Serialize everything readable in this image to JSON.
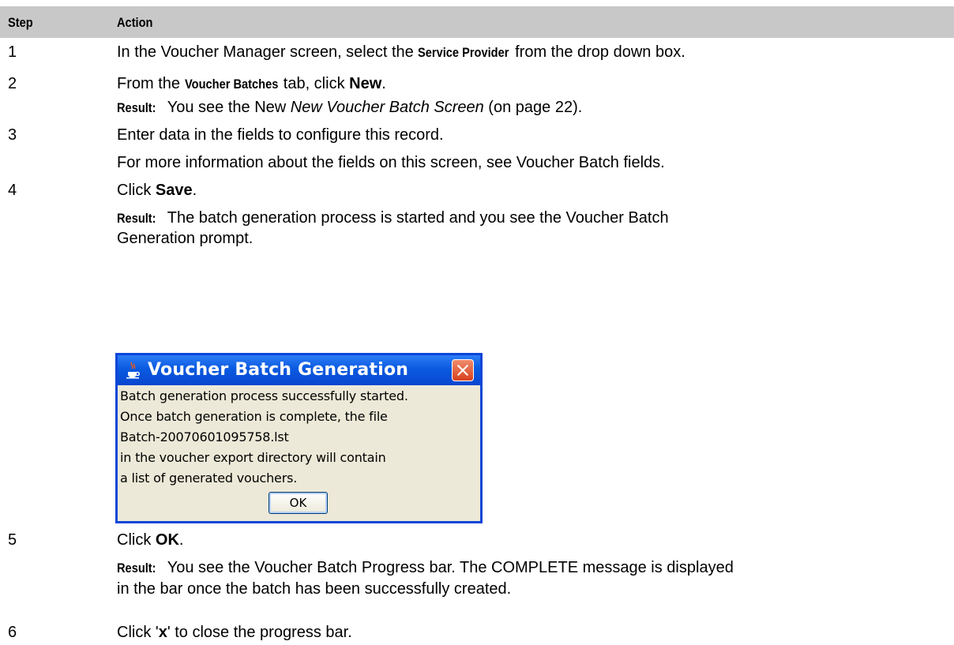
{
  "table": {
    "header_step": "Step",
    "header_action": "Action"
  },
  "steps": [
    {
      "num": "1",
      "pre": "In the Voucher Manager screen, select the ",
      "bold": "Service Provider",
      "post": " from the drop down box."
    },
    {
      "num": "2",
      "pre": "From the ",
      "bold": "Voucher Batches",
      "mid": " tab, click ",
      "bold2": "New",
      "post": "."
    },
    {
      "result_label": "Result:",
      "result_pre": "You see the New ",
      "result_ital": "New Voucher Batch Screen",
      "result_post": " (on page 22)."
    },
    {
      "num": "3",
      "text": "Enter data in the fields to configure this record."
    },
    {
      "text": "For more information about the fields on this screen, see Voucher Batch fields."
    },
    {
      "num": "4",
      "pre": "Click ",
      "bold": "Save",
      "post": "."
    },
    {
      "result_label": "Result:",
      "line1": "The batch generation process is started and you see the Voucher Batch",
      "line2": "Generation prompt."
    },
    {
      "num": "5",
      "pre": "Click ",
      "bold": "OK",
      "post": "."
    },
    {
      "result_label": "Result:",
      "line1": "You see the Voucher Batch Progress bar. The COMPLETE message is displayed",
      "line2": "in the bar once the batch has been successfully created."
    },
    {
      "num": "6",
      "pre": "Click '",
      "bold": "x",
      "post": "' to close the progress bar."
    }
  ],
  "dialog": {
    "title": "Voucher Batch Generation",
    "lines": [
      "Batch generation process successfully started.",
      "Once batch generation is complete, the file",
      "Batch-20070601095758.lst",
      "in the voucher export directory will contain",
      "a list of generated vouchers."
    ],
    "ok_label": "OK",
    "icon": "java-cup-icon"
  }
}
